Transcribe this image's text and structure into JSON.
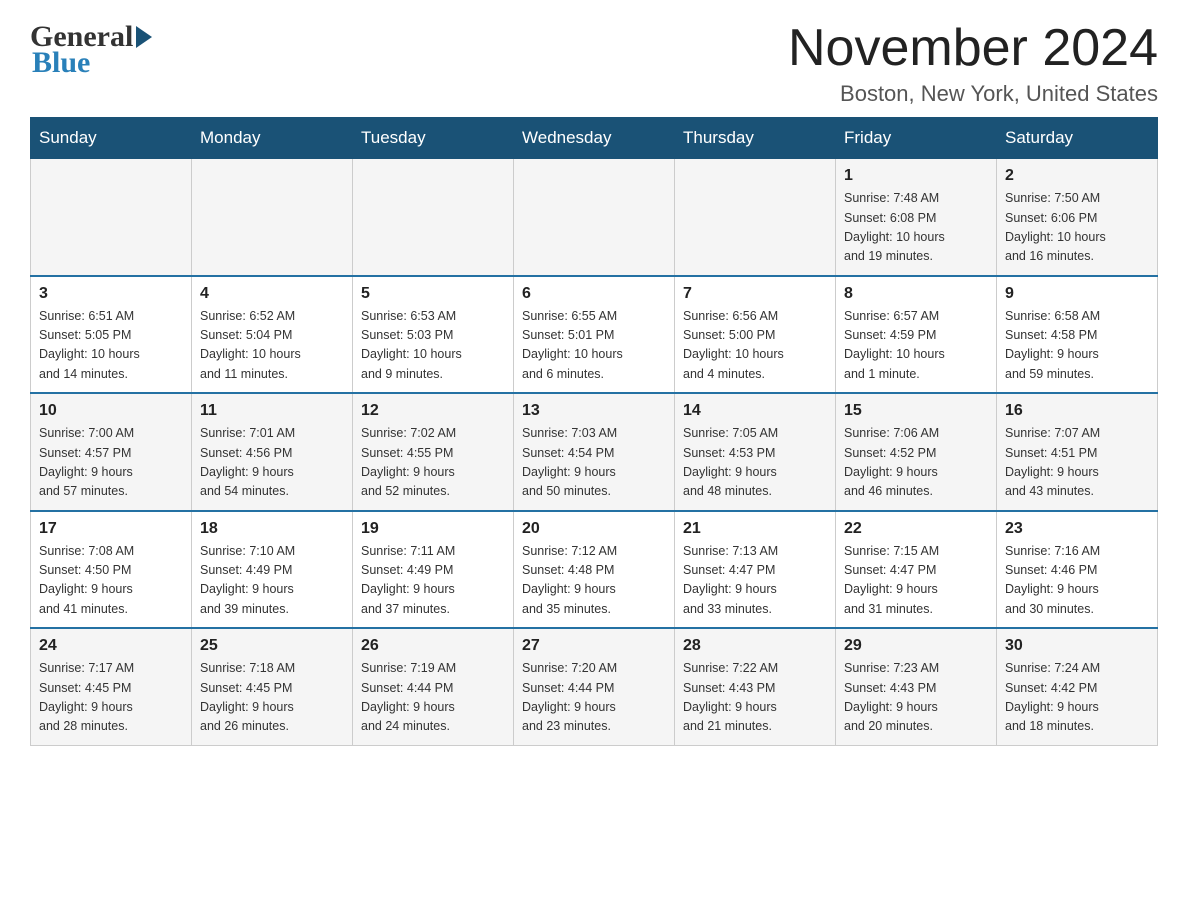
{
  "header": {
    "logo": {
      "general": "General",
      "blue": "Blue"
    },
    "title": "November 2024",
    "location": "Boston, New York, United States"
  },
  "weekdays": [
    "Sunday",
    "Monday",
    "Tuesday",
    "Wednesday",
    "Thursday",
    "Friday",
    "Saturday"
  ],
  "weeks": [
    [
      {
        "day": "",
        "info": ""
      },
      {
        "day": "",
        "info": ""
      },
      {
        "day": "",
        "info": ""
      },
      {
        "day": "",
        "info": ""
      },
      {
        "day": "",
        "info": ""
      },
      {
        "day": "1",
        "info": "Sunrise: 7:48 AM\nSunset: 6:08 PM\nDaylight: 10 hours\nand 19 minutes."
      },
      {
        "day": "2",
        "info": "Sunrise: 7:50 AM\nSunset: 6:06 PM\nDaylight: 10 hours\nand 16 minutes."
      }
    ],
    [
      {
        "day": "3",
        "info": "Sunrise: 6:51 AM\nSunset: 5:05 PM\nDaylight: 10 hours\nand 14 minutes."
      },
      {
        "day": "4",
        "info": "Sunrise: 6:52 AM\nSunset: 5:04 PM\nDaylight: 10 hours\nand 11 minutes."
      },
      {
        "day": "5",
        "info": "Sunrise: 6:53 AM\nSunset: 5:03 PM\nDaylight: 10 hours\nand 9 minutes."
      },
      {
        "day": "6",
        "info": "Sunrise: 6:55 AM\nSunset: 5:01 PM\nDaylight: 10 hours\nand 6 minutes."
      },
      {
        "day": "7",
        "info": "Sunrise: 6:56 AM\nSunset: 5:00 PM\nDaylight: 10 hours\nand 4 minutes."
      },
      {
        "day": "8",
        "info": "Sunrise: 6:57 AM\nSunset: 4:59 PM\nDaylight: 10 hours\nand 1 minute."
      },
      {
        "day": "9",
        "info": "Sunrise: 6:58 AM\nSunset: 4:58 PM\nDaylight: 9 hours\nand 59 minutes."
      }
    ],
    [
      {
        "day": "10",
        "info": "Sunrise: 7:00 AM\nSunset: 4:57 PM\nDaylight: 9 hours\nand 57 minutes."
      },
      {
        "day": "11",
        "info": "Sunrise: 7:01 AM\nSunset: 4:56 PM\nDaylight: 9 hours\nand 54 minutes."
      },
      {
        "day": "12",
        "info": "Sunrise: 7:02 AM\nSunset: 4:55 PM\nDaylight: 9 hours\nand 52 minutes."
      },
      {
        "day": "13",
        "info": "Sunrise: 7:03 AM\nSunset: 4:54 PM\nDaylight: 9 hours\nand 50 minutes."
      },
      {
        "day": "14",
        "info": "Sunrise: 7:05 AM\nSunset: 4:53 PM\nDaylight: 9 hours\nand 48 minutes."
      },
      {
        "day": "15",
        "info": "Sunrise: 7:06 AM\nSunset: 4:52 PM\nDaylight: 9 hours\nand 46 minutes."
      },
      {
        "day": "16",
        "info": "Sunrise: 7:07 AM\nSunset: 4:51 PM\nDaylight: 9 hours\nand 43 minutes."
      }
    ],
    [
      {
        "day": "17",
        "info": "Sunrise: 7:08 AM\nSunset: 4:50 PM\nDaylight: 9 hours\nand 41 minutes."
      },
      {
        "day": "18",
        "info": "Sunrise: 7:10 AM\nSunset: 4:49 PM\nDaylight: 9 hours\nand 39 minutes."
      },
      {
        "day": "19",
        "info": "Sunrise: 7:11 AM\nSunset: 4:49 PM\nDaylight: 9 hours\nand 37 minutes."
      },
      {
        "day": "20",
        "info": "Sunrise: 7:12 AM\nSunset: 4:48 PM\nDaylight: 9 hours\nand 35 minutes."
      },
      {
        "day": "21",
        "info": "Sunrise: 7:13 AM\nSunset: 4:47 PM\nDaylight: 9 hours\nand 33 minutes."
      },
      {
        "day": "22",
        "info": "Sunrise: 7:15 AM\nSunset: 4:47 PM\nDaylight: 9 hours\nand 31 minutes."
      },
      {
        "day": "23",
        "info": "Sunrise: 7:16 AM\nSunset: 4:46 PM\nDaylight: 9 hours\nand 30 minutes."
      }
    ],
    [
      {
        "day": "24",
        "info": "Sunrise: 7:17 AM\nSunset: 4:45 PM\nDaylight: 9 hours\nand 28 minutes."
      },
      {
        "day": "25",
        "info": "Sunrise: 7:18 AM\nSunset: 4:45 PM\nDaylight: 9 hours\nand 26 minutes."
      },
      {
        "day": "26",
        "info": "Sunrise: 7:19 AM\nSunset: 4:44 PM\nDaylight: 9 hours\nand 24 minutes."
      },
      {
        "day": "27",
        "info": "Sunrise: 7:20 AM\nSunset: 4:44 PM\nDaylight: 9 hours\nand 23 minutes."
      },
      {
        "day": "28",
        "info": "Sunrise: 7:22 AM\nSunset: 4:43 PM\nDaylight: 9 hours\nand 21 minutes."
      },
      {
        "day": "29",
        "info": "Sunrise: 7:23 AM\nSunset: 4:43 PM\nDaylight: 9 hours\nand 20 minutes."
      },
      {
        "day": "30",
        "info": "Sunrise: 7:24 AM\nSunset: 4:42 PM\nDaylight: 9 hours\nand 18 minutes."
      }
    ]
  ]
}
